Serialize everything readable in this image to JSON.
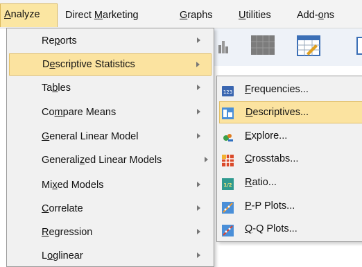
{
  "menubar": {
    "items": [
      {
        "pre": "",
        "ul": "A",
        "post": "nalyze"
      },
      {
        "pre": "Direct ",
        "ul": "M",
        "post": "arketing"
      },
      {
        "pre": "",
        "ul": "G",
        "post": "raphs"
      },
      {
        "pre": "",
        "ul": "U",
        "post": "tilities"
      },
      {
        "pre": "Add-",
        "ul": "o",
        "post": "ns"
      }
    ]
  },
  "analyze_menu": {
    "items": [
      {
        "pre": "Re",
        "ul": "p",
        "post": "orts"
      },
      {
        "pre": "D",
        "ul": "e",
        "post": "scriptive Statistics"
      },
      {
        "pre": "Ta",
        "ul": "b",
        "post": "les"
      },
      {
        "pre": "Co",
        "ul": "m",
        "post": "pare Means"
      },
      {
        "pre": "",
        "ul": "G",
        "post": "eneral Linear Model"
      },
      {
        "pre": "Generali",
        "ul": "z",
        "post": "ed Linear Models"
      },
      {
        "pre": "Mi",
        "ul": "x",
        "post": "ed Models"
      },
      {
        "pre": "",
        "ul": "C",
        "post": "orrelate"
      },
      {
        "pre": "",
        "ul": "R",
        "post": "egression"
      },
      {
        "pre": "L",
        "ul": "o",
        "post": "glinear"
      }
    ]
  },
  "descriptive_submenu": {
    "items": [
      {
        "pre": "",
        "ul": "F",
        "post": "requencies...",
        "icon": "frequencies-icon",
        "icon_text": "123"
      },
      {
        "pre": "",
        "ul": "D",
        "post": "escriptives...",
        "icon": "descriptives-icon",
        "icon_text": ""
      },
      {
        "pre": "",
        "ul": "E",
        "post": "xplore...",
        "icon": "explore-icon",
        "icon_text": ""
      },
      {
        "pre": "",
        "ul": "C",
        "post": "rosstabs...",
        "icon": "crosstabs-icon",
        "icon_text": ""
      },
      {
        "pre": "",
        "ul": "R",
        "post": "atio...",
        "icon": "ratio-icon",
        "icon_text": "1/2"
      },
      {
        "pre": "",
        "ul": "P",
        "post": "-P Plots...",
        "icon": "pp-plots-icon",
        "icon_text": ""
      },
      {
        "pre": "",
        "ul": "Q",
        "post": "-Q Plots...",
        "icon": "qq-plots-icon",
        "icon_text": ""
      }
    ]
  },
  "colors": {
    "highlight": "#fbe3a0",
    "highlight_border": "#e3c067",
    "menu_bg": "#f1f1f1"
  }
}
